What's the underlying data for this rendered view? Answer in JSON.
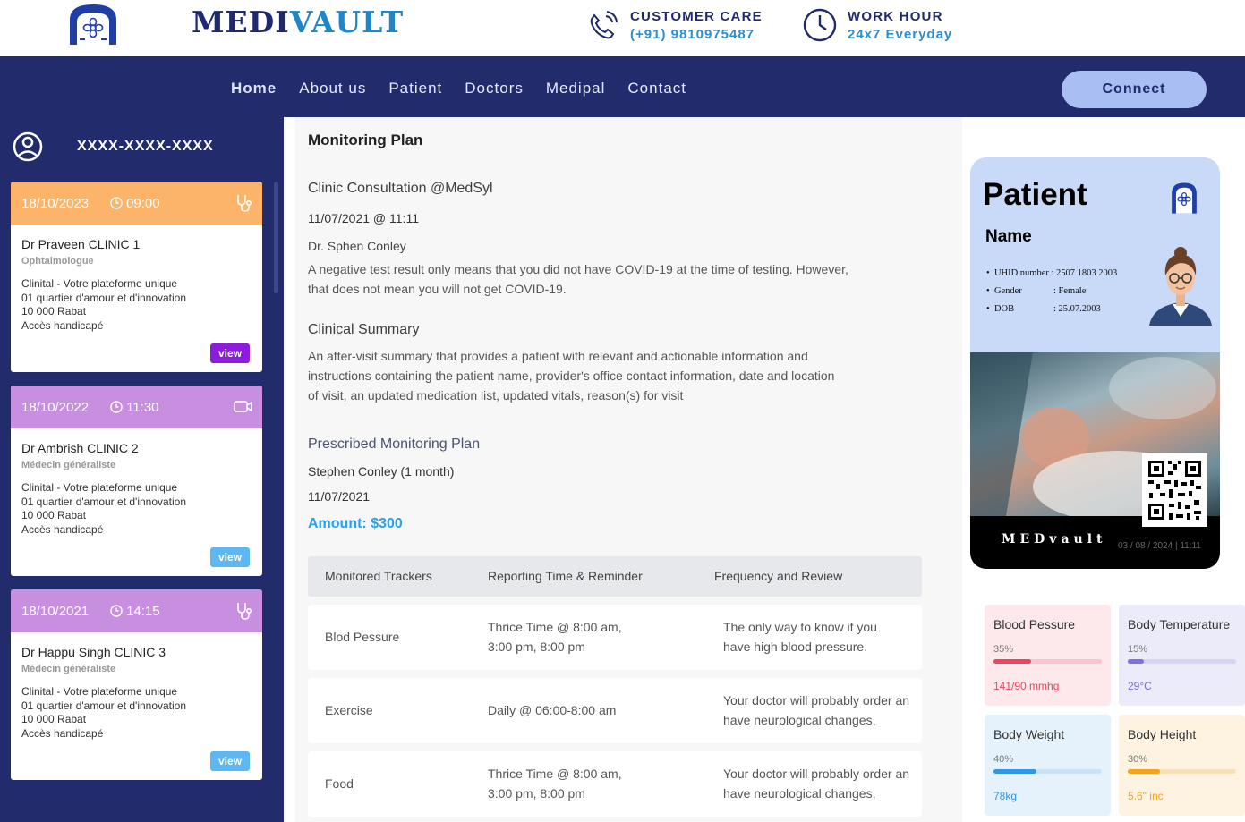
{
  "header": {
    "brand_a": "MEDI",
    "brand_b": "VAULT",
    "customer_care_label": "CUSTOMER CARE",
    "customer_care_phone": "(+91) 9810975487",
    "work_hour_label": "WORK HOUR",
    "work_hour_value": "24x7 Everyday"
  },
  "nav": {
    "items": [
      "Home",
      "About us",
      "Patient",
      "Doctors",
      "Medipal",
      "Contact"
    ],
    "connect": "Connect"
  },
  "sidebar": {
    "user_id": "XXXX-XXXX-XXXX",
    "cards": [
      {
        "date": "18/10/2023",
        "time": "09:00",
        "icon": "stethoscope-icon",
        "doctor": "Dr Praveen CLINIC 1",
        "specialty": "Ophtalmologue",
        "address": [
          "Clinital - Votre plateforme unique",
          "01 quartier d'amour et d'innovation",
          "10 000 Rabat",
          "Accès handicapé"
        ],
        "view": "view",
        "head_color": "#fbb46a",
        "view_color": "#8e1cdc"
      },
      {
        "date": "18/10/2022",
        "time": "11:30",
        "icon": "video-icon",
        "doctor": "Dr Ambrish CLINIC 2",
        "specialty": "Médecin généraliste",
        "address": [
          "Clinital - Votre plateforme unique",
          "01 quartier d'amour et d'innovation",
          "10 000 Rabat",
          "Accès handicapé"
        ],
        "view": "view",
        "head_color": "#c88ee0",
        "view_color": "#5cb7f2"
      },
      {
        "date": "18/10/2021",
        "time": "14:15",
        "icon": "stethoscope-icon",
        "doctor": "Dr Happu Singh CLINIC 3",
        "specialty": "Médecin généraliste",
        "address": [
          "Clinital - Votre plateforme unique",
          "01 quartier d'amour et d'innovation",
          "10 000 Rabat",
          "Accès handicapé"
        ],
        "view": "view",
        "head_color": "#c88ee0",
        "view_color": "#5cb7f2"
      }
    ]
  },
  "main": {
    "title": "Monitoring Plan",
    "consult_title": "Clinic Consultation @MedSyl",
    "consult_datetime": "11/07/2021 @ 11:11",
    "consult_doctor": "Dr. Sphen Conley",
    "consult_text_1": "A negative test result only means that you did not have COVID-19 at the time of testing. However,",
    "consult_text_2": "that does not mean you will not get COVID-19.",
    "summary_title": "Clinical Summary",
    "summary_1": "An after-visit summary that provides a patient with relevant and actionable information and",
    "summary_2": "instructions containing the patient name, provider's office contact information, date and location",
    "summary_3": "of visit, an updated medication list, updated vitals, reason(s) for visit",
    "plan_title": "Prescribed Monitoring Plan",
    "plan_who": "Stephen Conley (1 month)",
    "plan_date": "11/07/2021",
    "amount": "Amount: $300",
    "table_headers": [
      "Monitored Trackers",
      "Reporting Time & Reminder",
      "Frequency and Review"
    ],
    "rows": [
      {
        "tracker": "Blod Pessure",
        "time_1": "Thrice Time @ 8:00 am,",
        "time_2": "3:00 pm, 8:00 pm",
        "freq_1": "The only way to know if you",
        "freq_2": "have high blood pressure."
      },
      {
        "tracker": "Exercise",
        "time_1": "Daily @ 06:00-8:00 am",
        "time_2": "",
        "freq_1": "Your doctor will probably order an",
        "freq_2": "have neurological changes,"
      },
      {
        "tracker": "Food",
        "time_1": "Thrice Time @ 8:00 am,",
        "time_2": "3:00 pm, 8:00 pm",
        "freq_1": "Your doctor will probably order an",
        "freq_2": "have neurological changes,"
      }
    ]
  },
  "idcard": {
    "title": "Patient",
    "name": "Name",
    "uhid_label": "UHID number",
    "uhid_value": ": 2507 1803 2003",
    "gender_label": "Gender",
    "gender_value": ": Female",
    "dob_label": "DOB",
    "dob_value": ": 25.07.2003",
    "footer_brand": "MEDvault",
    "footer_date": "03 / 08 / 2024 | 11:11"
  },
  "vitals": [
    {
      "name": "Blood Pessure",
      "percent": "35%",
      "fill": 0.35,
      "value": "141/90 mmhg",
      "bg": "#fde8ec",
      "color": "#f0435e",
      "track": "#f7c6cf"
    },
    {
      "name": "Body Temperature",
      "percent": "15%",
      "fill": 0.15,
      "value": "29°C",
      "bg": "#ebebfa",
      "color": "#7b6cf0",
      "track": "#d6d4f5"
    },
    {
      "name": "Body Weight",
      "percent": "40%",
      "fill": 0.4,
      "value": "78kg",
      "bg": "#e6f2fb",
      "color": "#2d96e6",
      "track": "#c8e2f6"
    },
    {
      "name": "Body Height",
      "percent": "30%",
      "fill": 0.3,
      "value": "5.6\" inc",
      "bg": "#fdf3e0",
      "color": "#f7a21b",
      "track": "#f7e0b6"
    }
  ]
}
